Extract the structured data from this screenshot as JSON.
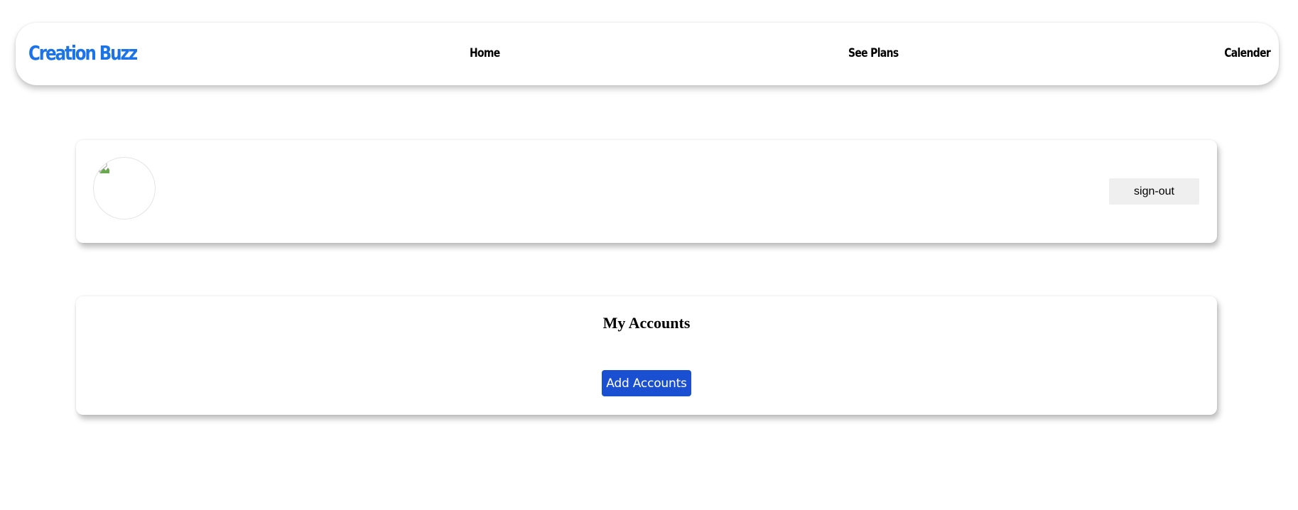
{
  "navbar": {
    "brand": "Creation Buzz",
    "links": [
      "Home",
      "See Plans",
      "Calender"
    ]
  },
  "profile": {
    "avatar_icon": "broken-image-icon",
    "signout_label": "sign-out"
  },
  "accounts": {
    "title": "My Accounts",
    "add_button_label": "Add Accounts"
  },
  "colors": {
    "brand": "#1a73e8",
    "primary_button": "#1a4fd1",
    "secondary_button": "#efefef"
  }
}
